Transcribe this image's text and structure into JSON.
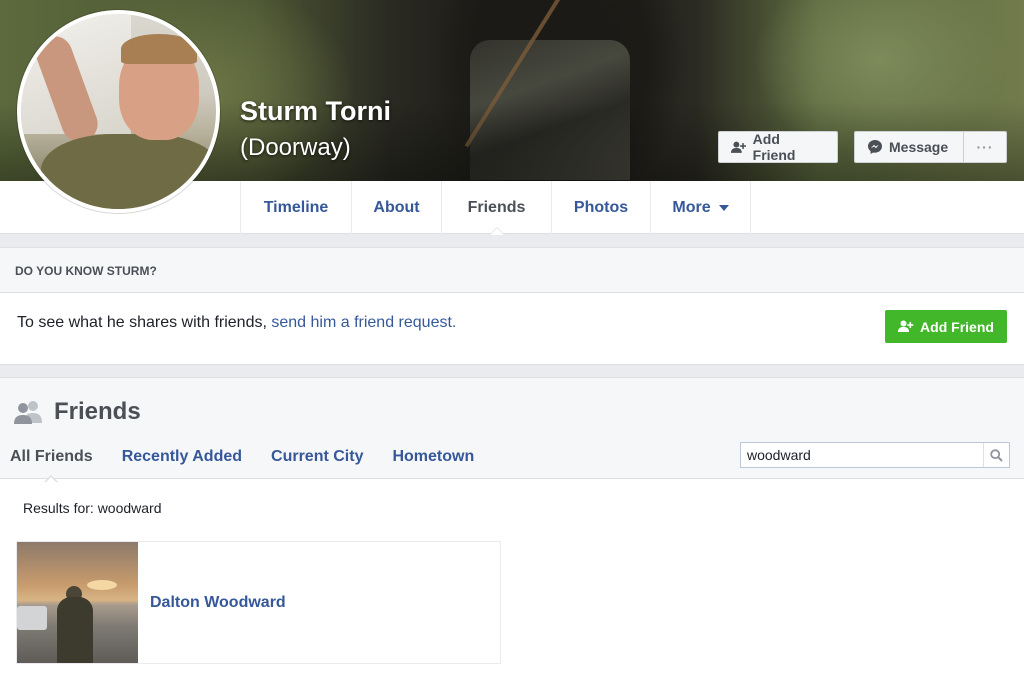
{
  "profile": {
    "name": "Sturm Torni",
    "alternate_name": "(Doorway)"
  },
  "cover_actions": {
    "add_friend_label": "Add Friend",
    "message_label": "Message",
    "more_label": "···"
  },
  "nav": {
    "tabs": [
      {
        "label": "Timeline"
      },
      {
        "label": "About"
      },
      {
        "label": "Friends",
        "active": true
      },
      {
        "label": "Photos"
      },
      {
        "label": "More"
      }
    ]
  },
  "know_box": {
    "heading": "DO YOU KNOW STURM?",
    "text": "To see what he shares with friends, ",
    "link_text": "send him a friend request.",
    "button_label": "Add Friend"
  },
  "friends": {
    "title": "Friends",
    "tabs": [
      {
        "label": "All Friends",
        "active": true
      },
      {
        "label": "Recently Added"
      },
      {
        "label": "Current City"
      },
      {
        "label": "Hometown"
      }
    ],
    "search_value": "woodward",
    "results_text": "Results for: woodward",
    "results": [
      {
        "name": "Dalton Woodward"
      }
    ]
  },
  "colors": {
    "link": "#365899",
    "green_button": "#42b72a",
    "page_bg": "#e9ebee"
  }
}
